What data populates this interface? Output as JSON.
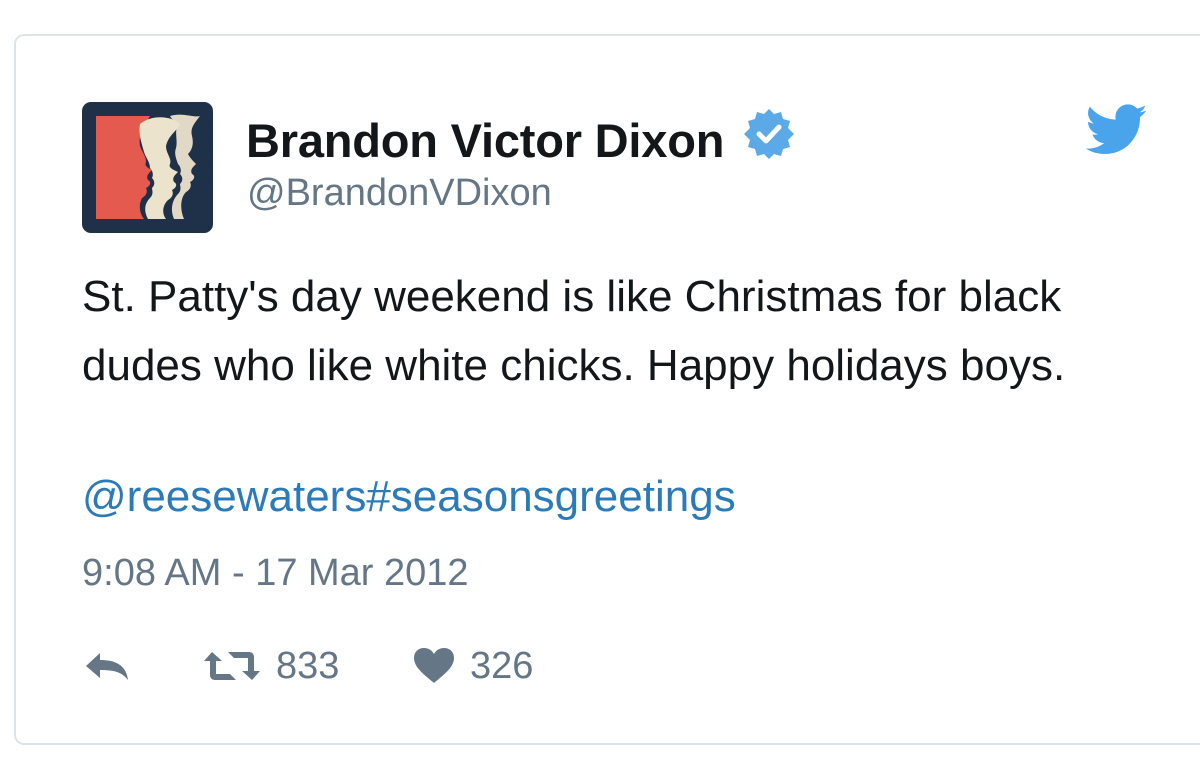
{
  "tweet": {
    "author_name": "Brandon Victor Dixon",
    "author_handle": "@BrandonVDixon",
    "text": "St. Patty's day weekend is like Christmas for black dudes who like white chicks. Happy holidays boys.",
    "mention": "@reesewaters",
    "hashtag": "#seasonsgreetings",
    "timestamp": "9:08 AM - 17 Mar 2012",
    "retweet_count": "833",
    "like_count": "326",
    "verified": true
  },
  "icons": {
    "avatar": "avatar-silhouette-logo",
    "verified": "verified-badge-icon",
    "brand": "twitter-bird-icon",
    "reply": "reply-icon",
    "retweet": "retweet-icon",
    "like": "heart-icon"
  },
  "colors": {
    "text": "#14171a",
    "secondary": "#657786",
    "link": "#2b7bb9",
    "verified": "#5ba9e6",
    "twitter_blue": "#4aa4ec",
    "avatar_bg": "#1f3148",
    "avatar_red": "#e55a4e",
    "avatar_cream": "#ece3cc",
    "card_border": "#dde4e9"
  }
}
